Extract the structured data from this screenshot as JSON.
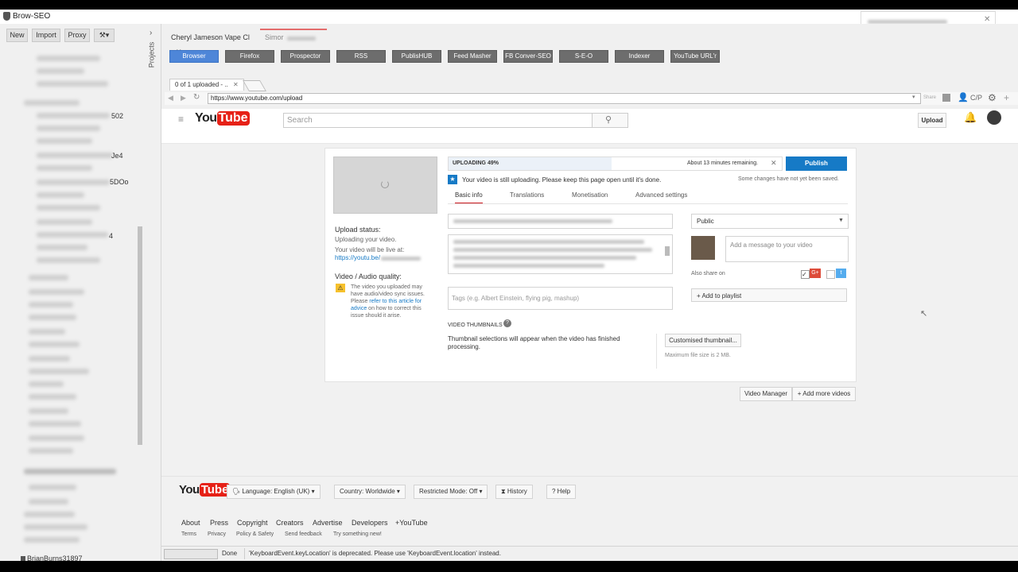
{
  "app": {
    "title": "Brow-SEO"
  },
  "left_toolbar": {
    "new": "New",
    "import": "Import",
    "proxy": "Proxy"
  },
  "tree_fragments": [
    "502",
    "Je4",
    "5DOo",
    "4"
  ],
  "projects_label": "Projects",
  "user": "BrianBurns31897",
  "doc_tabs": [
    {
      "label": "Cheryl Jameson Vape Cl"
    },
    {
      "label": "Simor"
    }
  ],
  "tools": [
    "Browser",
    "Firefox",
    "Prospector",
    "RSS",
    "PublisHUB",
    "Feed Masher",
    "FB Conver-SEO",
    "S-E-O",
    "Indexer",
    "YouTube URL'r"
  ],
  "inner_tab": "0 of 1 uploaded - ..",
  "url": "https://www.youtube.com/upload",
  "addr_right": {
    "share": "Share",
    "cp": "C/P"
  },
  "yt": {
    "logo_you": "You",
    "logo_tube": "Tube",
    "search_placeholder": "Search",
    "upload": "Upload"
  },
  "upload": {
    "progress_label": "UPLOADING 49%",
    "progress": 0.49,
    "time_remaining": "About 13 minutes remaining.",
    "publish": "Publish",
    "notice": "Your video is still uploading. Please keep this page open until it's done.",
    "unsaved": "Some changes have not yet been saved.",
    "tabs": [
      "Basic info",
      "Translations",
      "Monetisation",
      "Advanced settings"
    ],
    "status_heading": "Upload status:",
    "status_line1": "Uploading your video.",
    "status_line2": "Your video will be live at:",
    "status_link": "https://youtu.be/",
    "quality_heading": "Video / Audio quality:",
    "quality_text": "The video you uploaded may have audio/video sync issues. Please ",
    "quality_link": "refer to this article for advice",
    "quality_text2": " on how to correct this issue should it arise.",
    "tags_placeholder": "Tags (e.g. Albert Einstein, flying pig, mashup)",
    "privacy": "Public",
    "message_placeholder": "Add a message to your video",
    "also_share": "Also share on",
    "add_playlist": "+ Add to playlist",
    "thumb_heading": "VIDEO THUMBNAILS",
    "thumb_text": "Thumbnail selections will appear when the video has finished processing.",
    "custom_thumb": "Customised thumbnail...",
    "max_size": "Maximum file size is 2 MB.",
    "video_manager": "Video Manager",
    "add_more": "+ Add more videos"
  },
  "footer": {
    "language": "Language: English (UK)",
    "country": "Country: Worldwide",
    "restricted": "Restricted Mode: Off",
    "history": "History",
    "help": "Help",
    "links1": [
      "About",
      "Press",
      "Copyright",
      "Creators",
      "Advertise",
      "Developers",
      "+YouTube"
    ],
    "links2": [
      "Terms",
      "Privacy",
      "Policy & Safety",
      "Send feedback",
      "Try something new!"
    ]
  },
  "status": {
    "done": "Done",
    "message": "'KeyboardEvent.keyLocation' is deprecated. Please use 'KeyboardEvent.location' instead."
  }
}
